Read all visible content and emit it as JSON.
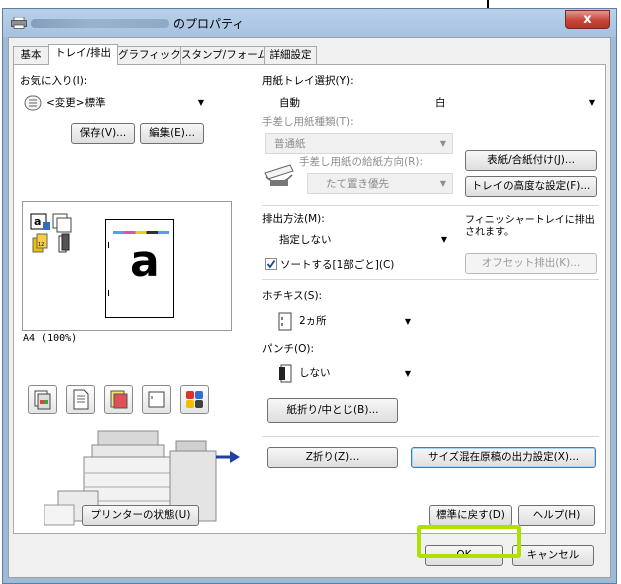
{
  "window": {
    "title": "のプロパティ",
    "close_label": "x"
  },
  "tabs": [
    {
      "label": "基本"
    },
    {
      "label": "トレイ/排出"
    },
    {
      "label": "グラフィックス"
    },
    {
      "label": "スタンプ/フォーム"
    },
    {
      "label": "詳細設定"
    }
  ],
  "left": {
    "favorites_label": "お気に入り(I):",
    "favorites_value": "<変更>標準",
    "save_button": "保存(V)...",
    "edit_button": "編集(E)...",
    "preview_caption": "A4 (100%)",
    "preview_letter": "a",
    "printer_status_button": "プリンターの状態(U)"
  },
  "tray": {
    "label": "用紙トレイ選択(Y):",
    "value": "自動",
    "color": "白"
  },
  "manual_feed": {
    "paper_type_label": "手差し用紙種類(T):",
    "paper_type_value": "普通紙",
    "direction_label": "手差し用紙の給紙方向(R):",
    "direction_value": "たて置き優先"
  },
  "right_buttons": {
    "cover": "表紙/合紙付け(J)...",
    "tray_advanced": "トレイの高度な設定(F)..."
  },
  "output": {
    "label": "排出方法(M):",
    "value": "指定しない",
    "note": "フィニッシャートレイに排出されます。",
    "offset_button": "オフセット排出(K)...",
    "sort_label": "ソートする[1部ごと](C)",
    "sort_checked": true
  },
  "staple": {
    "label": "ホチキス(S):",
    "value": "2ヵ所"
  },
  "punch": {
    "label": "パンチ(O):",
    "value": "しない"
  },
  "fold": {
    "booklet_button": "紙折り/中とじ(B)...",
    "zfold_button": "Z折り(Z)...",
    "mixed_size_button": "サイズ混在原稿の出力設定(X)..."
  },
  "bottom": {
    "restore_button": "標準に戻す(D)",
    "help_button": "ヘルプ(H)",
    "ok_button": "OK",
    "cancel_button": "キャンセル"
  },
  "colors": {
    "ok_highlight": "#aee000",
    "title_bar": "#b9d1ea",
    "close_button": "#c8463a"
  }
}
